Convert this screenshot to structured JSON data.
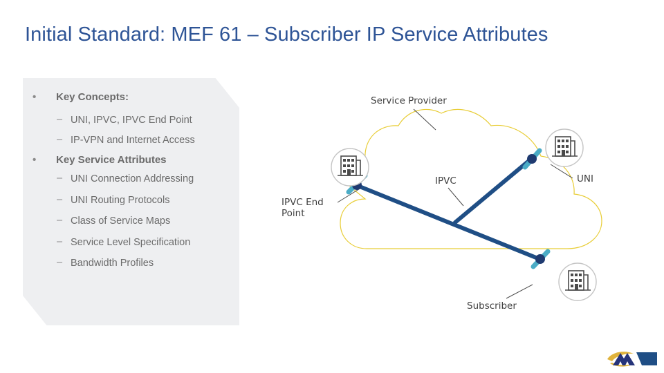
{
  "slide": {
    "title": "Initial Standard: MEF 61 – Subscriber IP Service Attributes",
    "title_color": "#2e5496",
    "background": "#ffffff"
  },
  "content_panel": {
    "background": "#eeeff1",
    "bullets": [
      {
        "level": 1,
        "marker": "•",
        "text": "Key Concepts:"
      },
      {
        "level": 2,
        "marker": "–",
        "text": "UNI, IPVC, IPVC End Point"
      },
      {
        "level": 2,
        "marker": "–",
        "text": "IP-VPN and Internet Access"
      },
      {
        "level": 1,
        "marker": "•",
        "text": "Key Service Attributes"
      },
      {
        "level": 2,
        "marker": "–",
        "text": "UNI Connection Addressing"
      },
      {
        "level": 2,
        "marker": "–",
        "text": "UNI Routing Protocols"
      },
      {
        "level": 2,
        "marker": "–",
        "text": "Class of Service Maps"
      },
      {
        "level": 2,
        "marker": "–",
        "text": "Service Level Specification"
      },
      {
        "level": 2,
        "marker": "–",
        "text": "Bandwidth Profiles"
      }
    ]
  },
  "diagram": {
    "cloud_color": "#e8cd36",
    "link_color": "#1f4e85",
    "node_color": "#1f3a70",
    "marker_color": "#4bacc6",
    "icon_color": "#4a4a4a",
    "icon_ring_color": "#c4c4c4",
    "leader_color": "#4a4a4a",
    "labels": {
      "service_provider": "Service Provider",
      "ipvc": "IPVC",
      "ipvc_end_point": "IPVC End Point",
      "uni": "UNI",
      "subscriber": "Subscriber"
    },
    "icons": {
      "building_left": "building-icon",
      "building_top_right": "building-icon",
      "building_bottom_right": "building-icon"
    }
  },
  "logo": {
    "name": "mef-logo",
    "mark_color": "#26347a",
    "swoosh_color": "#e0b33c",
    "block_color": "#1f4e85"
  }
}
